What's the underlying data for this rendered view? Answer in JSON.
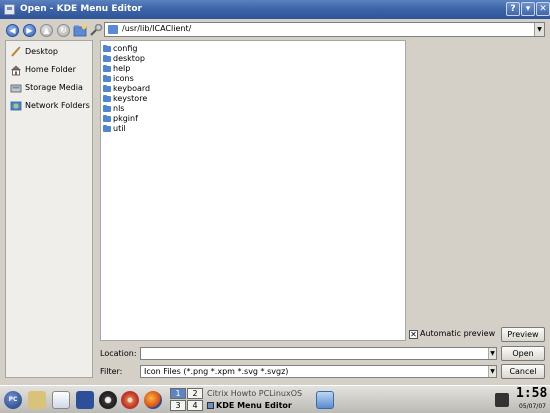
{
  "window": {
    "title": "Open - KDE Menu Editor",
    "help_label": "?",
    "minimize_label": "▾",
    "close_label": "✕"
  },
  "toolbar": {
    "back_icon": "back-arrow-icon",
    "forward_icon": "forward-arrow-icon",
    "up_icon": "up-arrow-icon",
    "reload_icon": "reload-icon",
    "new_folder_icon": "new-folder-icon",
    "configure_icon": "configure-wrench-icon",
    "path": "/usr/lib/ICAClient/"
  },
  "places": [
    {
      "label": "Desktop",
      "icon": "desktop-icon"
    },
    {
      "label": "Home Folder",
      "icon": "home-folder-icon"
    },
    {
      "label": "Storage Media",
      "icon": "storage-media-icon"
    },
    {
      "label": "Network Folders",
      "icon": "network-folders-icon"
    }
  ],
  "files": [
    "config",
    "desktop",
    "help",
    "icons",
    "keyboard",
    "keystore",
    "nls",
    "pkginf",
    "util"
  ],
  "preview": {
    "auto_label": "Automatic preview",
    "auto_checked": "✕",
    "button_label": "Preview"
  },
  "location": {
    "label": "Location:",
    "value": "",
    "button": "Open"
  },
  "filter": {
    "label": "Filter:",
    "value": "Icon Files (*.png *.xpm *.svg *.svgz)",
    "button": "Cancel"
  },
  "taskbar": {
    "pager": [
      "1",
      "2",
      "3",
      "4"
    ],
    "tasks": [
      "Citrix Howto PCLinuxOS",
      "KDE Menu Editor"
    ],
    "clock": "1:58",
    "date": "05/07/07",
    "start_label": "PC"
  }
}
